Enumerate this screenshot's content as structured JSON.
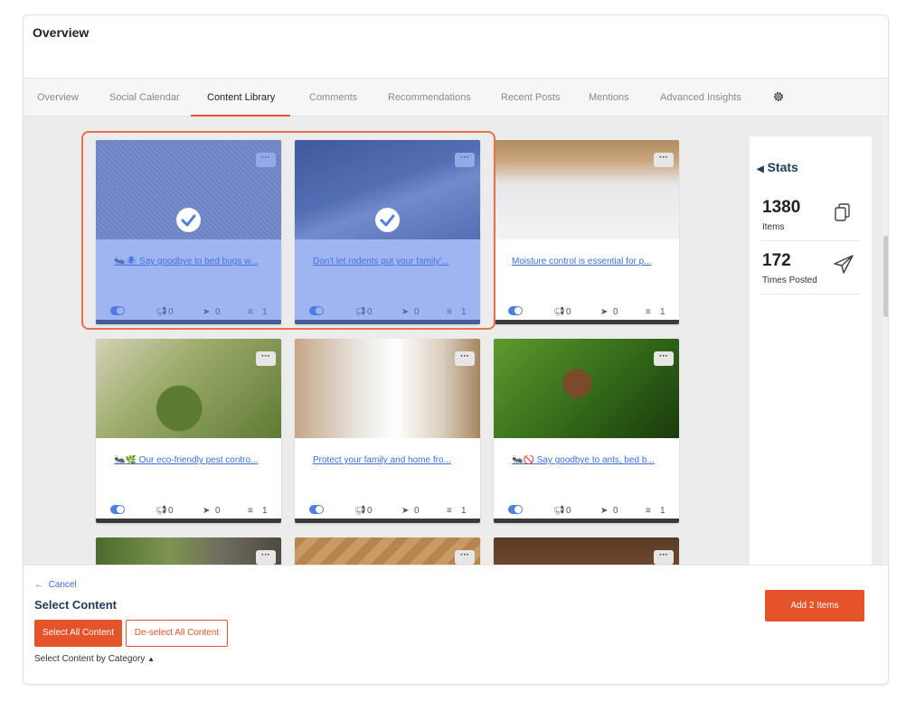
{
  "header": {
    "title": "Overview"
  },
  "tabs": [
    {
      "label": "Overview"
    },
    {
      "label": "Social Calendar"
    },
    {
      "label": "Content Library"
    },
    {
      "label": "Comments"
    },
    {
      "label": "Recommendations"
    },
    {
      "label": "Recent Posts"
    },
    {
      "label": "Mentions"
    },
    {
      "label": "Advanced Insights"
    }
  ],
  "active_tab": "Content Library",
  "colors": {
    "accent": "#e5532a",
    "link": "#3a6fd8",
    "selection_overlay": "#5078e6",
    "heading": "#1f3b5c"
  },
  "cards": [
    {
      "caption": "🐜🕷 Say goodbye to bed bugs w...",
      "stats": {
        "boost": "0",
        "sent": "0",
        "lines": "1"
      },
      "selected": true,
      "image": "gray-fabric"
    },
    {
      "caption": "Don't let rodents put your family'...",
      "stats": {
        "boost": "0",
        "sent": "0",
        "lines": "1"
      },
      "selected": true,
      "image": "rodent-corner"
    },
    {
      "caption": "Moisture control is essential for p...",
      "stats": {
        "boost": "0",
        "sent": "0",
        "lines": "1"
      },
      "selected": false,
      "image": "crawlspace"
    },
    {
      "caption": "🐜🌿 Our eco-friendly pest contro...",
      "stats": {
        "boost": "0",
        "sent": "0",
        "lines": "1"
      },
      "selected": false,
      "image": "spray-plant"
    },
    {
      "caption": "Protect your family and home fro...",
      "stats": {
        "boost": "0",
        "sent": "0",
        "lines": "1"
      },
      "selected": false,
      "image": "exterminator"
    },
    {
      "caption": "🐜🚫 Say goodbye to ants, bed b...",
      "stats": {
        "boost": "0",
        "sent": "0",
        "lines": "1"
      },
      "selected": false,
      "image": "stink-bug"
    },
    {
      "caption": "",
      "stats": null,
      "selected": false,
      "image": "raccoon"
    },
    {
      "caption": "",
      "stats": null,
      "selected": false,
      "image": "wood-floor"
    },
    {
      "caption": "",
      "stats": null,
      "selected": false,
      "image": "termite-wood"
    }
  ],
  "stats_panel": {
    "title": "Stats",
    "items_value": "1380",
    "items_label": "Items",
    "posted_value": "172",
    "posted_label": "Times Posted"
  },
  "footer": {
    "cancel": "Cancel",
    "title": "Select Content",
    "select_all": "Select All Content",
    "deselect_all": "De-select All Content",
    "by_category": "Select Content by Category",
    "add_button": "Add 2 Items"
  },
  "icons": {
    "more": "more-dots-icon",
    "toggle": "toggle-icon",
    "boost": "megaphone-icon",
    "sent": "send-icon",
    "lines": "lines-icon",
    "check": "checkmark-icon",
    "gear": "gear-icon",
    "copy": "copy-icon",
    "paper_plane": "paper-plane-icon",
    "back_arrow": "back-arrow-icon",
    "caret": "caret-up-icon",
    "stats_caret": "caret-left-icon"
  }
}
